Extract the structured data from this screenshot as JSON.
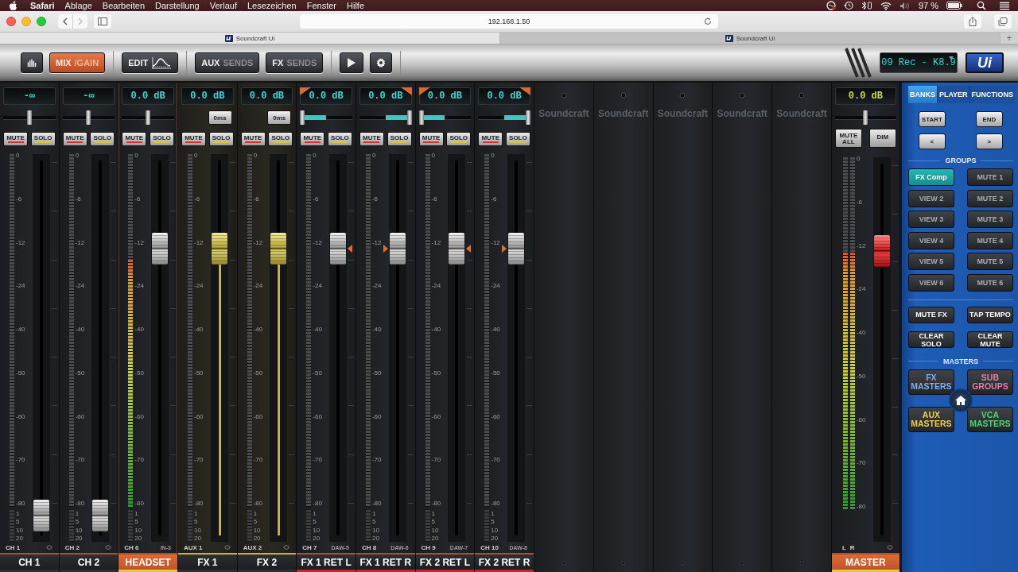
{
  "menubar": {
    "menus": [
      "Safari",
      "Ablage",
      "Bearbeiten",
      "Darstellung",
      "Verlauf",
      "Lesezeichen",
      "Fenster",
      "Hilfe"
    ],
    "battery": "97 %"
  },
  "browser": {
    "address": "192.168.1.50",
    "tabs": [
      {
        "title": "Soundcraft Ui",
        "selected": true
      },
      {
        "title": "Soundcraft Ui",
        "selected": false
      }
    ],
    "new_tab": "+"
  },
  "toolbar": {
    "groups": [
      [
        {
          "kind": "meters",
          "selected": false
        },
        {
          "kind": "text",
          "main": "MIX",
          "sub": "/GAIN",
          "selected": true
        }
      ],
      [
        {
          "kind": "edit",
          "main": "EDIT",
          "selected": false
        }
      ],
      [
        {
          "kind": "text",
          "main": "AUX",
          "sub": "SENDS",
          "selected": false
        },
        {
          "kind": "text",
          "main": "FX",
          "sub": "SENDS",
          "selected": false
        }
      ],
      [
        {
          "kind": "play",
          "selected": false
        },
        {
          "kind": "settings",
          "selected": false
        }
      ]
    ],
    "snapshot": "09 Rec - K8.9",
    "logo": "Ui"
  },
  "strips": [
    {
      "kind": "channel",
      "display": "-∞",
      "pan": {
        "kind": "balance",
        "level": 0.5
      },
      "buttons": [
        "MUTE",
        "SOLO"
      ],
      "scale": [
        "0",
        "-6",
        "-12",
        "-24",
        "-40",
        "-50",
        "-60",
        "-70",
        "-80"
      ],
      "gr_scale": [
        "1",
        "5",
        "10",
        "20"
      ],
      "fader": {
        "level": 0.03
      },
      "short": "CH 1",
      "name": "CH 1",
      "selected": false
    },
    {
      "kind": "channel",
      "display": "-∞",
      "pan": {
        "kind": "balance",
        "level": 0.5
      },
      "buttons": [
        "MUTE",
        "SOLO"
      ],
      "scale": [
        "0",
        "-6",
        "-12",
        "-24",
        "-40",
        "-50",
        "-60",
        "-70",
        "-80"
      ],
      "gr_scale": [
        "1",
        "5",
        "10",
        "20"
      ],
      "fader": {
        "level": 0.03
      },
      "short": "CH 2",
      "name": "CH 2",
      "selected": false
    },
    {
      "kind": "channel",
      "display": "0.0 dB",
      "pan": {
        "kind": "balance",
        "level": 0.5
      },
      "buttons": [
        "MUTE",
        "SOLO"
      ],
      "scale": [
        "0",
        "-6",
        "-12",
        "-24",
        "-40",
        "-50",
        "-60",
        "-70",
        "-80"
      ],
      "gr_scale": [
        "1",
        "5",
        "10",
        "20"
      ],
      "meter": {
        "level": 0.7
      },
      "fader": {
        "level": 0.78
      },
      "short": "CH 6",
      "source": "IN-3",
      "name": "HEADSET",
      "selected": true
    },
    {
      "kind": "aux",
      "display": "0.0 dB",
      "pan": {
        "kind": "delay",
        "label": "0ms"
      },
      "buttons": [
        "MUTE",
        "SOLO"
      ],
      "scale": [
        "0",
        "-6",
        "-12",
        "-24",
        "-40",
        "-50",
        "-60",
        "-70",
        "-80"
      ],
      "gr_scale": [
        "1",
        "5",
        "10",
        "20"
      ],
      "fader": {
        "level": 0.78
      },
      "short": "AUX 1",
      "name": "FX 1",
      "selected": false
    },
    {
      "kind": "aux",
      "display": "0.0 dB",
      "pan": {
        "kind": "delay",
        "label": "0ms"
      },
      "buttons": [
        "MUTE",
        "SOLO"
      ],
      "scale": [
        "0",
        "-6",
        "-12",
        "-24",
        "-40",
        "-50",
        "-60",
        "-70",
        "-80"
      ],
      "gr_scale": [
        "1",
        "5",
        "10",
        "20"
      ],
      "fader": {
        "level": 0.78
      },
      "short": "AUX 2",
      "name": "FX 2",
      "selected": false
    },
    {
      "kind": "fxreturn",
      "display": "0.0 dB",
      "pan": {
        "kind": "balance",
        "level": 0
      },
      "buttons": [
        "MUTE",
        "SOLO"
      ],
      "scale": [
        "0",
        "-6",
        "-12",
        "-24",
        "-40",
        "-50",
        "-60",
        "-70",
        "-80"
      ],
      "gr_scale": [
        "1",
        "5",
        "10",
        "20"
      ],
      "fader": {
        "level": 0.78
      },
      "short": "CH 7",
      "source": "DAW-5",
      "name": "FX 1 RET L",
      "selected": false
    },
    {
      "kind": "fxreturn",
      "display": "0.0 dB",
      "pan": {
        "kind": "balance",
        "level": 1
      },
      "buttons": [
        "MUTE",
        "SOLO"
      ],
      "scale": [
        "0",
        "-6",
        "-12",
        "-24",
        "-40",
        "-50",
        "-60",
        "-70",
        "-80"
      ],
      "gr_scale": [
        "1",
        "5",
        "10",
        "20"
      ],
      "fader": {
        "level": 0.78
      },
      "short": "CH 8",
      "source": "DAW-6",
      "name": "FX 1 RET R",
      "selected": false
    },
    {
      "kind": "fxreturn",
      "display": "0.0 dB",
      "pan": {
        "kind": "balance",
        "level": 0
      },
      "buttons": [
        "MUTE",
        "SOLO"
      ],
      "scale": [
        "0",
        "-6",
        "-12",
        "-24",
        "-40",
        "-50",
        "-60",
        "-70",
        "-80"
      ],
      "gr_scale": [
        "1",
        "5",
        "10",
        "20"
      ],
      "fader": {
        "level": 0.78
      },
      "short": "CH 9",
      "source": "DAW-7",
      "name": "FX 2 RET L",
      "selected": false
    },
    {
      "kind": "fxreturn",
      "display": "0.0 dB",
      "pan": {
        "kind": "balance",
        "level": 1
      },
      "buttons": [
        "MUTE",
        "SOLO"
      ],
      "scale": [
        "0",
        "-6",
        "-12",
        "-24",
        "-40",
        "-50",
        "-60",
        "-70",
        "-80"
      ],
      "gr_scale": [
        "1",
        "5",
        "10",
        "20"
      ],
      "fader": {
        "level": 0.78
      },
      "short": "CH 10",
      "source": "DAW-8",
      "name": "FX 2 RET R",
      "selected": false
    }
  ],
  "empty_slots": [
    {
      "label": "Soundcraft"
    },
    {
      "label": "Soundcraft"
    },
    {
      "label": "Soundcraft"
    },
    {
      "label": "Soundcraft"
    },
    {
      "label": "Soundcraft"
    }
  ],
  "master": {
    "display": "0.0 dB",
    "pan": {
      "kind": "balance",
      "level": 0.5
    },
    "buttons": [
      "MUTE ALL",
      "DIM"
    ],
    "scale": [
      "0",
      "-6",
      "-12",
      "-24",
      "-40",
      "-50",
      "-60",
      "-70",
      "-80"
    ],
    "meters": [
      {
        "label": "L",
        "level": 0.73
      },
      {
        "label": "R",
        "level": 0.73
      }
    ],
    "fader": {
      "level": 0.78
    },
    "name": "MASTER"
  },
  "side_panel": {
    "tabs": [
      {
        "label": "BANKS",
        "selected": true
      },
      {
        "label": "PLAYER",
        "selected": false
      },
      {
        "label": "FUNCTIONS",
        "selected": false
      }
    ],
    "bank_buttons": [
      "START",
      "END",
      "<",
      ">"
    ],
    "groups_heading": "GROUPS",
    "groups": [
      {
        "label": "FX Comp",
        "selected": true
      },
      {
        "label": "MUTE 1",
        "selected": false
      },
      {
        "label": "VIEW 2",
        "selected": false
      },
      {
        "label": "MUTE 2",
        "selected": false
      },
      {
        "label": "VIEW 3",
        "selected": false
      },
      {
        "label": "MUTE 3",
        "selected": false
      },
      {
        "label": "VIEW 4",
        "selected": false
      },
      {
        "label": "MUTE 4",
        "selected": false
      },
      {
        "label": "VIEW 5",
        "selected": false
      },
      {
        "label": "MUTE 5",
        "selected": false
      },
      {
        "label": "VIEW 6",
        "selected": false
      },
      {
        "label": "MUTE 6",
        "selected": false
      }
    ],
    "function_buttons": [
      "MUTE FX",
      "TAP TEMPO",
      "CLEAR SOLO",
      "CLEAR MUTE"
    ],
    "masters_heading": "MASTERS",
    "masters": [
      {
        "label": "FX MASTERS",
        "color": "#7fb0ea"
      },
      {
        "label": "SUB GROUPS",
        "color": "#e27fa6"
      },
      {
        "label": "AUX MASTERS",
        "color": "#e8d04e"
      },
      {
        "label": "VCA MASTERS",
        "color": "#4fd472"
      }
    ]
  }
}
